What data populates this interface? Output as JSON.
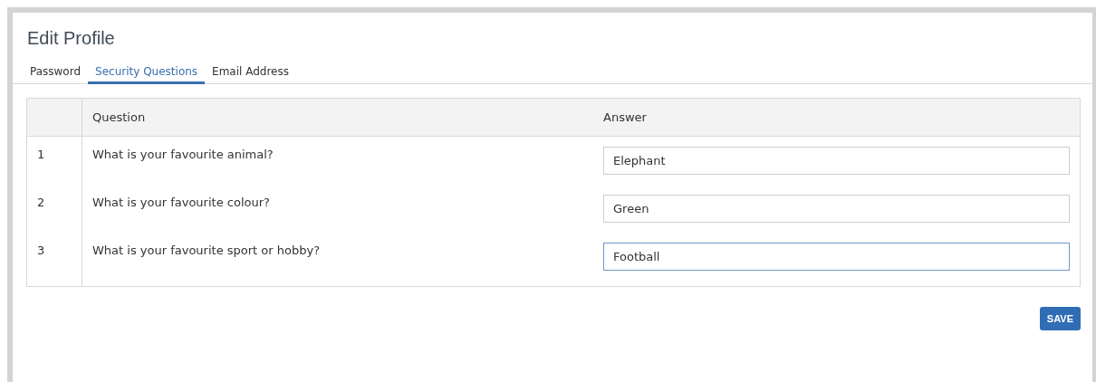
{
  "page": {
    "title": "Edit Profile"
  },
  "tabs": [
    {
      "label": "Password",
      "selected": false
    },
    {
      "label": "Security Questions",
      "selected": true
    },
    {
      "label": "Email Address",
      "selected": false
    }
  ],
  "table": {
    "columns": [
      "Question",
      "Answer"
    ],
    "rows": [
      {
        "number": "1",
        "question": "What is your favourite animal?",
        "answer": "Elephant",
        "focused": false
      },
      {
        "number": "2",
        "question": "What is your favourite colour?",
        "answer": "Green",
        "focused": false
      },
      {
        "number": "3",
        "question": "What is your favourite sport or hobby?",
        "answer": "Football",
        "focused": true
      }
    ]
  },
  "buttons": [
    "SAVE"
  ]
}
